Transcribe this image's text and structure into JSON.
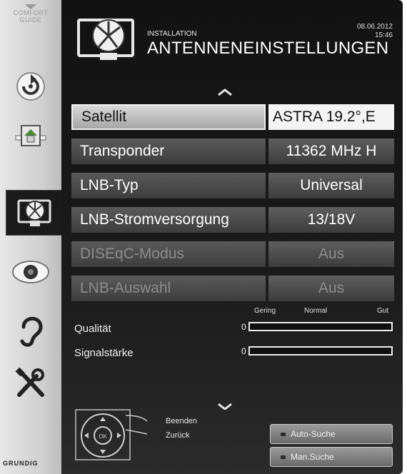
{
  "sidebar": {
    "top_label_1": "COMFORT",
    "top_label_2": "GUIDE",
    "brand": "GRUNDIG",
    "icons": [
      "refresh-icon",
      "house-icon",
      "satellite-dish-icon",
      "eye-icon",
      "ear-icon",
      "tools-icon"
    ],
    "active_index": 2
  },
  "header": {
    "subtitle": "INSTALLATION",
    "title": "ANTENNENEINSTELLUNGEN",
    "date": "08.06.2012",
    "time": "15:46"
  },
  "settings": [
    {
      "label": "Satellit",
      "value": "ASTRA 19.2°,E",
      "state": "selected"
    },
    {
      "label": "Transponder",
      "value": "11362 MHz H",
      "state": "normal"
    },
    {
      "label": "LNB-Typ",
      "value": "Universal",
      "state": "normal"
    },
    {
      "label": "LNB-Stromversorgung",
      "value": "13/18V",
      "state": "normal"
    },
    {
      "label": "DISEqC-Modus",
      "value": "Aus",
      "state": "disabled"
    },
    {
      "label": "LNB-Auswahl",
      "value": "Aus",
      "state": "disabled"
    }
  ],
  "meters": {
    "scale": [
      "Gering",
      "Normal",
      "Gut"
    ],
    "quality": {
      "label": "Qualität",
      "value_text": "0",
      "level": 0
    },
    "strength": {
      "label": "Signalstärke",
      "value_text": "0",
      "level": 0
    }
  },
  "help": {
    "exit": "Beenden",
    "back": "Zurück",
    "ok": "OK"
  },
  "buttons": {
    "auto_search": "Auto-Suche",
    "manual_search": "Man.Suche"
  },
  "colors": {
    "panel_bg": "#151515",
    "selected_row": "#f4f4f4",
    "disabled_text": "#8c8c8c"
  }
}
